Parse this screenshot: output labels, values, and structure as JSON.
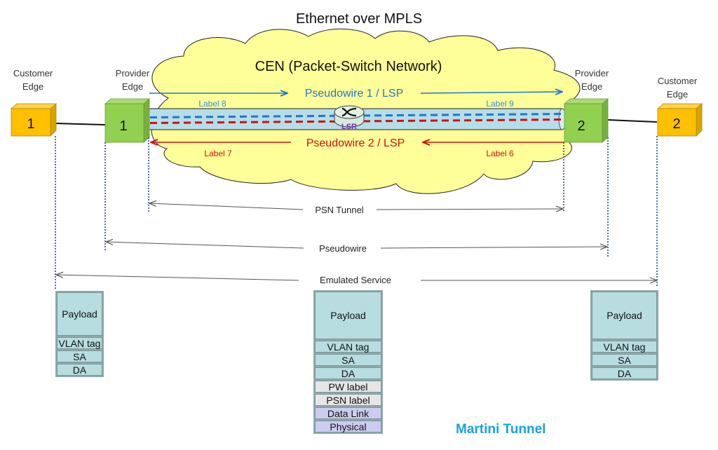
{
  "title": "Ethernet over MPLS",
  "cloud_label": "CEN (Packet-Switch Network)",
  "customer_edge_1": {
    "label": "Customer\nEdge",
    "line1": "Customer",
    "line2": "Edge",
    "number": "1"
  },
  "customer_edge_2": {
    "label": "Customer\nEdge",
    "line1": "Customer",
    "line2": "Edge",
    "number": "2"
  },
  "provider_edge_1": {
    "line1": "Provider",
    "line2": "Edge",
    "number": "1"
  },
  "provider_edge_2": {
    "line1": "Provider",
    "line2": "Edge",
    "number": "2"
  },
  "lsr_label": "LSR",
  "pseudowire_1": {
    "label": "Pseudowire 1 / LSP",
    "label_in": "Label 8",
    "label_out": "Label 9",
    "color": "#1f78c8"
  },
  "pseudowire_2": {
    "label": "Pseudowire 2 / LSP",
    "label_in": "Label 6",
    "label_out": "Label 7",
    "color": "#cc1111"
  },
  "spans": {
    "psn_tunnel": "PSN Tunnel",
    "pseudowire": "Pseudowire",
    "emulated_service": "Emulated Service"
  },
  "stacks": {
    "left": [
      "Payload",
      "VLAN tag",
      "SA",
      "DA"
    ],
    "center": [
      "Payload",
      "VLAN tag",
      "SA",
      "DA",
      "PW label",
      "PSN label",
      "Data Link",
      "Physical"
    ],
    "right": [
      "Payload",
      "VLAN tag",
      "SA",
      "DA"
    ]
  },
  "footer_title": "Martini Tunnel",
  "colors": {
    "cloud_fill": "#ffff99",
    "tube_fill": "#b7dde8",
    "provider_edge": "#92d050",
    "customer_edge": "#ffc000",
    "accent": "#1ba1e2"
  }
}
